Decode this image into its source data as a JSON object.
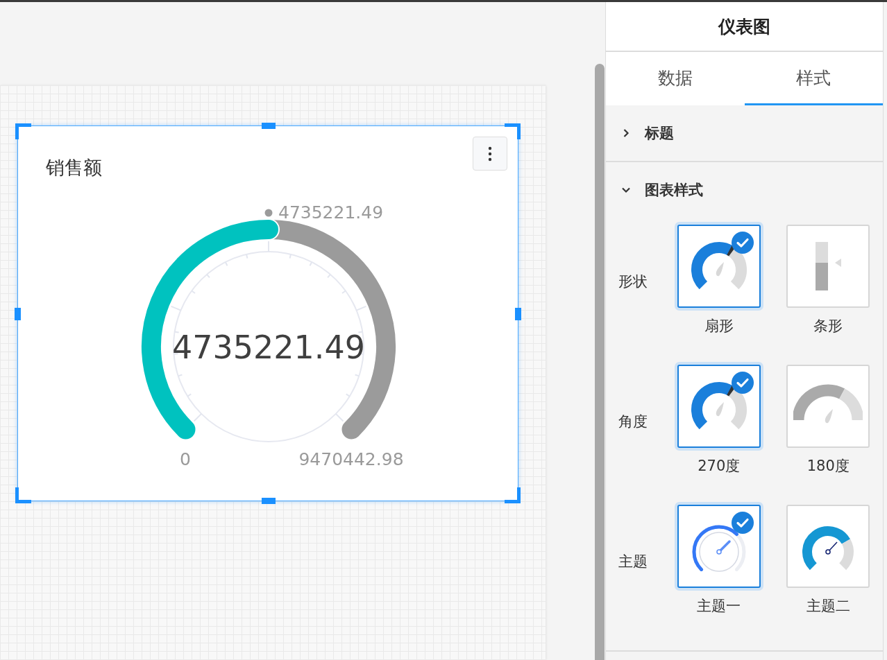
{
  "widget": {
    "title": "销售额",
    "value": "4735221.49",
    "pointer_label": "4735221.49",
    "min_label": "0",
    "max_label": "9470442.98",
    "level": 0.5
  },
  "panel": {
    "title": "仪表图",
    "tabs": [
      {
        "label": "数据",
        "selected": false
      },
      {
        "label": "样式",
        "selected": true
      }
    ],
    "sections": [
      {
        "title": "标题",
        "expanded": false
      },
      {
        "title": "图表样式",
        "expanded": true,
        "rows": [
          {
            "label": "形状",
            "options": [
              {
                "label": "扇形",
                "kind": "fan",
                "selected": true
              },
              {
                "label": "条形",
                "kind": "bar",
                "selected": false
              }
            ]
          },
          {
            "label": "角度",
            "options": [
              {
                "label": "270度",
                "kind": "fan",
                "selected": true
              },
              {
                "label": "180度",
                "kind": "half",
                "selected": false
              }
            ]
          },
          {
            "label": "主题",
            "options": [
              {
                "label": "主题一",
                "kind": "ringed",
                "selected": true
              },
              {
                "label": "主题二",
                "kind": "solid",
                "selected": false
              }
            ]
          }
        ]
      }
    ]
  }
}
